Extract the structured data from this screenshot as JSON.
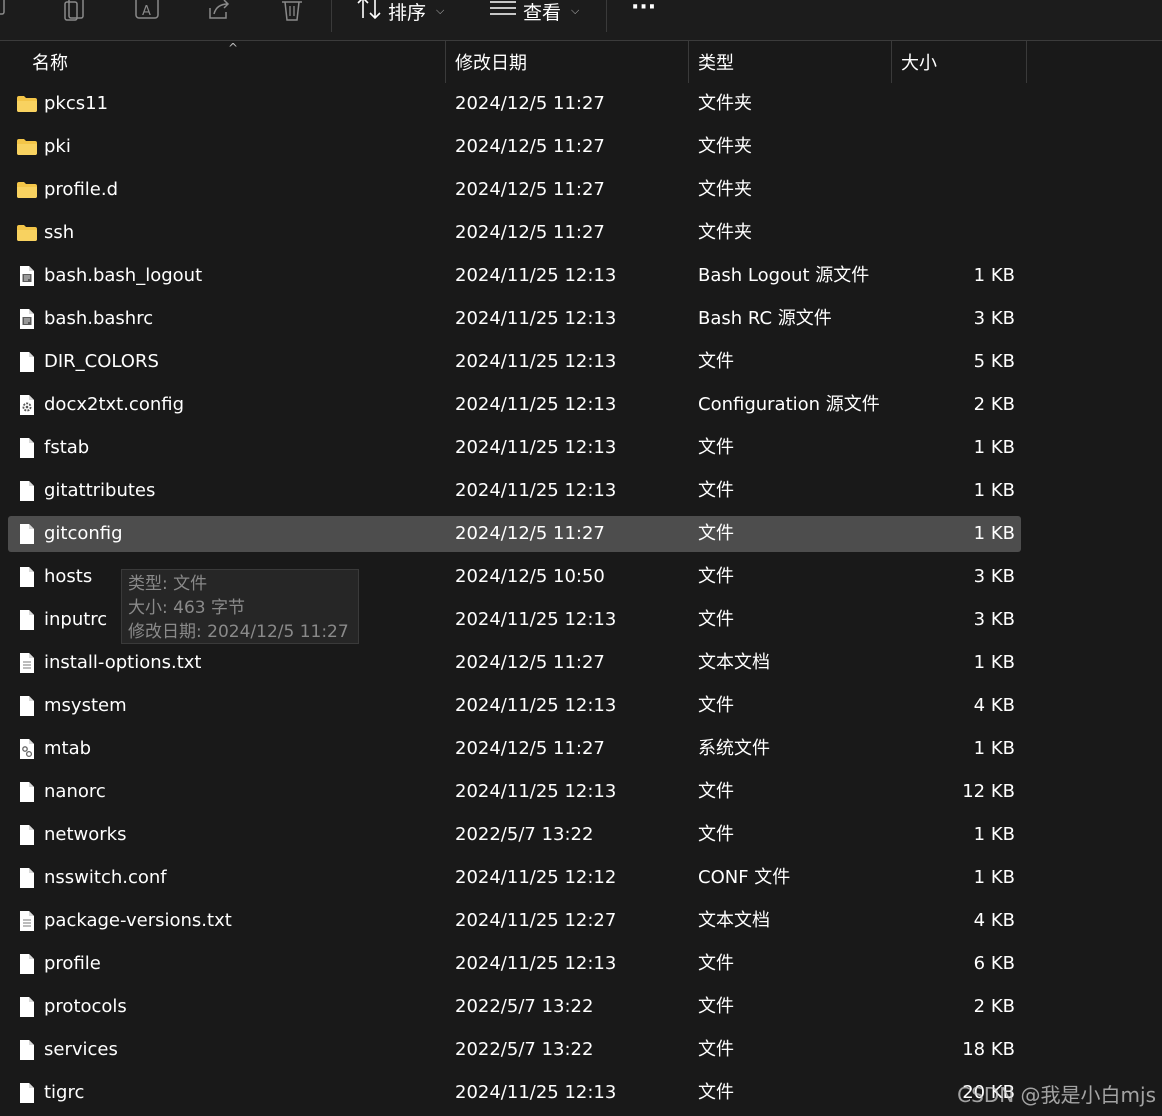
{
  "toolbar": {
    "icons": [
      "copy-icon",
      "paste-icon",
      "rename-icon",
      "share-icon",
      "delete-icon"
    ],
    "sort_label": "排序",
    "view_label": "查看",
    "more_label": "···"
  },
  "columns": {
    "name": "名称",
    "date": "修改日期",
    "type": "类型",
    "size": "大小"
  },
  "rows": [
    {
      "name": "pkcs11",
      "date": "2024/12/5 11:27",
      "type": "文件夹",
      "size": "",
      "icon": "folder-icon"
    },
    {
      "name": "pki",
      "date": "2024/12/5 11:27",
      "type": "文件夹",
      "size": "",
      "icon": "folder-icon"
    },
    {
      "name": "profile.d",
      "date": "2024/12/5 11:27",
      "type": "文件夹",
      "size": "",
      "icon": "folder-icon"
    },
    {
      "name": "ssh",
      "date": "2024/12/5 11:27",
      "type": "文件夹",
      "size": "",
      "icon": "folder-icon"
    },
    {
      "name": "bash.bash_logout",
      "date": "2024/11/25 12:13",
      "type": "Bash Logout 源文件",
      "size": "1 KB",
      "icon": "script-file-icon"
    },
    {
      "name": "bash.bashrc",
      "date": "2024/11/25 12:13",
      "type": "Bash RC 源文件",
      "size": "3 KB",
      "icon": "script-file-icon"
    },
    {
      "name": "DIR_COLORS",
      "date": "2024/11/25 12:13",
      "type": "文件",
      "size": "5 KB",
      "icon": "file-icon"
    },
    {
      "name": "docx2txt.config",
      "date": "2024/11/25 12:13",
      "type": "Configuration 源文件",
      "size": "2 KB",
      "icon": "config-file-icon"
    },
    {
      "name": "fstab",
      "date": "2024/11/25 12:13",
      "type": "文件",
      "size": "1 KB",
      "icon": "file-icon"
    },
    {
      "name": "gitattributes",
      "date": "2024/11/25 12:13",
      "type": "文件",
      "size": "1 KB",
      "icon": "file-icon"
    },
    {
      "name": "gitconfig",
      "date": "2024/12/5 11:27",
      "type": "文件",
      "size": "1 KB",
      "icon": "file-icon",
      "selected": true
    },
    {
      "name": "hosts",
      "date": "2024/12/5 10:50",
      "type": "文件",
      "size": "3 KB",
      "icon": "file-icon"
    },
    {
      "name": "inputrc",
      "date": "2024/11/25 12:13",
      "type": "文件",
      "size": "3 KB",
      "icon": "file-icon"
    },
    {
      "name": "install-options.txt",
      "date": "2024/12/5 11:27",
      "type": "文本文档",
      "size": "1 KB",
      "icon": "text-file-icon"
    },
    {
      "name": "msystem",
      "date": "2024/11/25 12:13",
      "type": "文件",
      "size": "4 KB",
      "icon": "file-icon"
    },
    {
      "name": "mtab",
      "date": "2024/12/5 11:27",
      "type": "系统文件",
      "size": "1 KB",
      "icon": "system-file-icon"
    },
    {
      "name": "nanorc",
      "date": "2024/11/25 12:13",
      "type": "文件",
      "size": "12 KB",
      "icon": "file-icon"
    },
    {
      "name": "networks",
      "date": "2022/5/7 13:22",
      "type": "文件",
      "size": "1 KB",
      "icon": "file-icon"
    },
    {
      "name": "nsswitch.conf",
      "date": "2024/11/25 12:12",
      "type": "CONF 文件",
      "size": "1 KB",
      "icon": "file-icon"
    },
    {
      "name": "package-versions.txt",
      "date": "2024/11/25 12:27",
      "type": "文本文档",
      "size": "4 KB",
      "icon": "text-file-icon"
    },
    {
      "name": "profile",
      "date": "2024/11/25 12:13",
      "type": "文件",
      "size": "6 KB",
      "icon": "file-icon"
    },
    {
      "name": "protocols",
      "date": "2022/5/7 13:22",
      "type": "文件",
      "size": "2 KB",
      "icon": "file-icon"
    },
    {
      "name": "services",
      "date": "2022/5/7 13:22",
      "type": "文件",
      "size": "18 KB",
      "icon": "file-icon"
    },
    {
      "name": "tigrc",
      "date": "2024/11/25 12:13",
      "type": "文件",
      "size": "20 KB",
      "icon": "file-icon"
    }
  ],
  "tooltip": {
    "type_line": "类型: 文件",
    "size_line": "大小: 463 字节",
    "date_line": "修改日期: 2024/12/5 11:27"
  },
  "watermark": "CSDN @我是小白mjs",
  "colors": {
    "background": "#191919",
    "selected_row": "#4d4d4d",
    "folder": "#f3c548",
    "text": "#ffffff",
    "muted": "#8a8a8a"
  }
}
